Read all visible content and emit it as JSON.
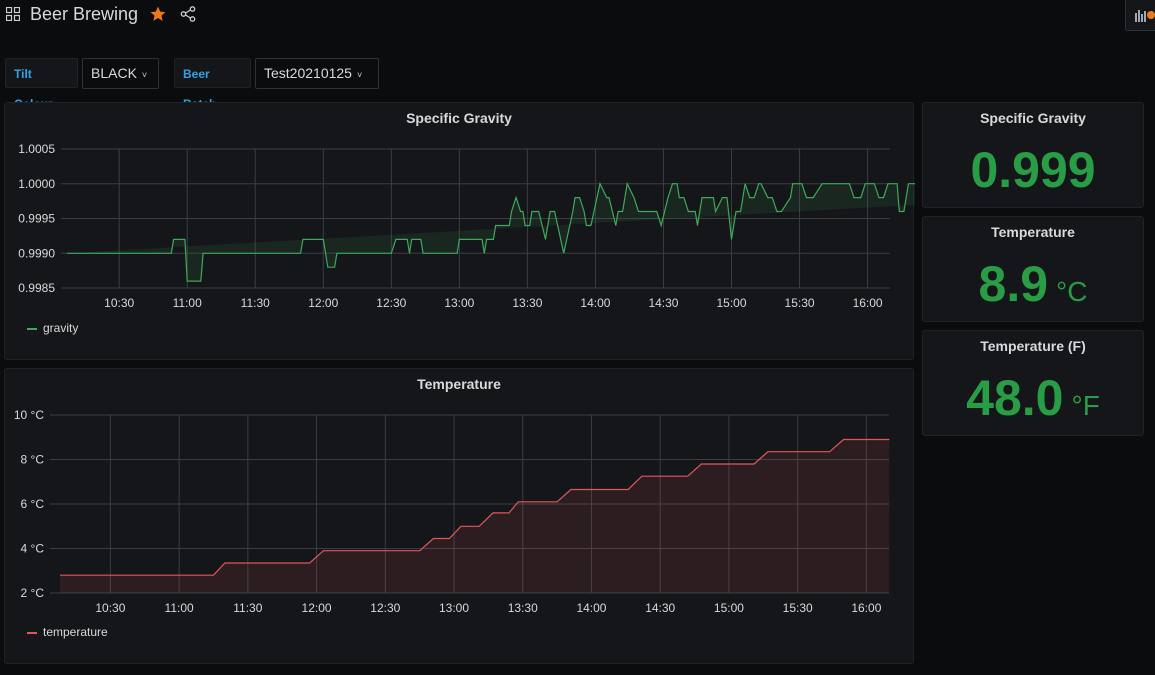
{
  "header": {
    "title": "Beer Brewing",
    "icons": {
      "apps": "apps-grid-icon",
      "star": "star-icon",
      "share": "share-icon",
      "add_panel": "add-panel-icon"
    },
    "star_color": "#eb7b18"
  },
  "variables": [
    {
      "label": "Tilt Colour",
      "value": "BLACK"
    },
    {
      "label": "Beer Batch",
      "value": "Test20210125"
    }
  ],
  "panels": {
    "gravity_stat": {
      "title": "Specific Gravity",
      "value": "0.999",
      "unit": ""
    },
    "temp_stat": {
      "title": "Temperature",
      "value": "8.9",
      "unit": "°C"
    },
    "tempf_stat": {
      "title": "Temperature (F)",
      "value": "48.0",
      "unit": "°F"
    }
  },
  "colors": {
    "stat_green": "#299c46",
    "gravity_line": "#3ea85b",
    "temperature_line": "#e0575a"
  },
  "chart_data": [
    {
      "type": "area",
      "title": "Specific Gravity",
      "xlabel": "",
      "ylabel": "",
      "x_unit": "minutes after 10:00",
      "xticks": [
        "10:30",
        "11:00",
        "11:30",
        "12:00",
        "12:30",
        "13:00",
        "13:30",
        "14:00",
        "14:30",
        "15:00",
        "15:30",
        "16:00"
      ],
      "xlim": [
        "10:07",
        "16:09"
      ],
      "yticks": [
        "1.0005",
        "1.0000",
        "0.9995",
        "0.9990",
        "0.9985"
      ],
      "ylim": [
        0.9985,
        1.0005
      ],
      "grid": true,
      "legend": "bottom-left",
      "series": [
        {
          "name": "gravity",
          "x": [
            7,
            53,
            54,
            59,
            60,
            66,
            67,
            110,
            111,
            120,
            122,
            125,
            126,
            150,
            152,
            157,
            158,
            159,
            163,
            164,
            179,
            180,
            190,
            191,
            192,
            195,
            196,
            202,
            203,
            205,
            207,
            208,
            209,
            211,
            212,
            215,
            218,
            220,
            222,
            226,
            230,
            231,
            233,
            235,
            236,
            238,
            242,
            245,
            246,
            249,
            250,
            252,
            254,
            257,
            259,
            261,
            263,
            267,
            269,
            272,
            274,
            276,
            277,
            279,
            281,
            284,
            285,
            287,
            288,
            292,
            293,
            296,
            298,
            300,
            302,
            304,
            306,
            308,
            310,
            312,
            313,
            316,
            318,
            320,
            322,
            326,
            327,
            331,
            333,
            336,
            340,
            343,
            345,
            348,
            350,
            352,
            354,
            357,
            359,
            361,
            363,
            365,
            367,
            369,
            371,
            373,
            374,
            376,
            378,
            381,
            383,
            385,
            387,
            391,
            393,
            396,
            398,
            400,
            402,
            404,
            408,
            410,
            412,
            414,
            416,
            418,
            420,
            422,
            423,
            425,
            427,
            430,
            432,
            436,
            437,
            438,
            439
          ],
          "values": [
            0.999,
            0.999,
            0.9992,
            0.9992,
            0.9986,
            0.9986,
            0.999,
            0.999,
            0.9992,
            0.9992,
            0.9988,
            0.9988,
            0.999,
            0.999,
            0.9992,
            0.9992,
            0.999,
            0.9992,
            0.9992,
            0.999,
            0.999,
            0.9992,
            0.9992,
            0.999,
            0.9992,
            0.9992,
            0.9994,
            0.9994,
            0.9996,
            0.9998,
            0.9996,
            0.9996,
            0.9994,
            0.9994,
            0.9996,
            0.9996,
            0.9992,
            0.9996,
            0.9996,
            0.999,
            0.9996,
            0.9998,
            0.9998,
            0.9996,
            0.9994,
            0.9994,
            1.0,
            0.9998,
            0.9998,
            0.9994,
            0.9996,
            0.9996,
            1.0,
            0.9998,
            0.9996,
            0.9996,
            0.9996,
            0.9996,
            0.9994,
            0.9998,
            1.0,
            1.0,
            0.9998,
            0.9998,
            0.9996,
            0.9996,
            0.9994,
            0.9998,
            0.9998,
            0.9998,
            0.9996,
            0.9998,
            0.9998,
            0.9992,
            0.9996,
            0.9996,
            1.0,
            0.9998,
            0.9998,
            1.0,
            1.0,
            0.9998,
            0.9998,
            0.9996,
            0.9996,
            0.9998,
            1.0,
            1.0,
            0.9998,
            0.9998,
            1.0,
            1.0,
            1.0,
            1.0,
            1.0,
            1.0,
            0.9998,
            0.9998,
            1.0,
            1.0,
            1.0,
            0.9998,
            0.9998,
            1.0,
            1.0,
            1.0,
            0.9996,
            0.9996,
            1.0,
            1.0,
            1.0,
            1.0,
            1.0,
            1.0,
            1.0,
            1.0,
            1.0,
            1.0,
            1.0,
            1.0,
            1.0,
            1.0,
            1.0,
            1.0,
            1.0,
            1.0,
            1.0,
            1.0,
            1.0,
            1.0,
            1.0,
            1.0,
            1.0,
            1.0,
            0.9998
          ]
        }
      ]
    },
    {
      "type": "area",
      "title": "Temperature",
      "xlabel": "",
      "ylabel": "",
      "x_unit": "minutes after 10:00",
      "xticks": [
        "10:30",
        "11:00",
        "11:30",
        "12:00",
        "12:30",
        "13:00",
        "13:30",
        "14:00",
        "14:30",
        "15:00",
        "15:30",
        "16:00"
      ],
      "xlim": [
        "10:08",
        "16:09"
      ],
      "yticks": [
        "10 °C",
        "8 °C",
        "6 °C",
        "4 °C",
        "2 °C"
      ],
      "ylim": [
        2,
        10
      ],
      "grid": true,
      "legend": "bottom-left",
      "series": [
        {
          "name": "temperature",
          "x": [
            8,
            75,
            80,
            117,
            123,
            165,
            171,
            178,
            183,
            191,
            197,
            204,
            208,
            225,
            231,
            256,
            262,
            282,
            288,
            311,
            317,
            344,
            350,
            370
          ],
          "values": [
            2.8,
            2.8,
            3.35,
            3.35,
            3.9,
            3.9,
            4.45,
            4.45,
            5.0,
            5.0,
            5.6,
            5.6,
            6.1,
            6.1,
            6.65,
            6.65,
            7.25,
            7.25,
            7.8,
            7.8,
            8.35,
            8.35,
            8.9,
            8.9
          ]
        }
      ]
    }
  ]
}
